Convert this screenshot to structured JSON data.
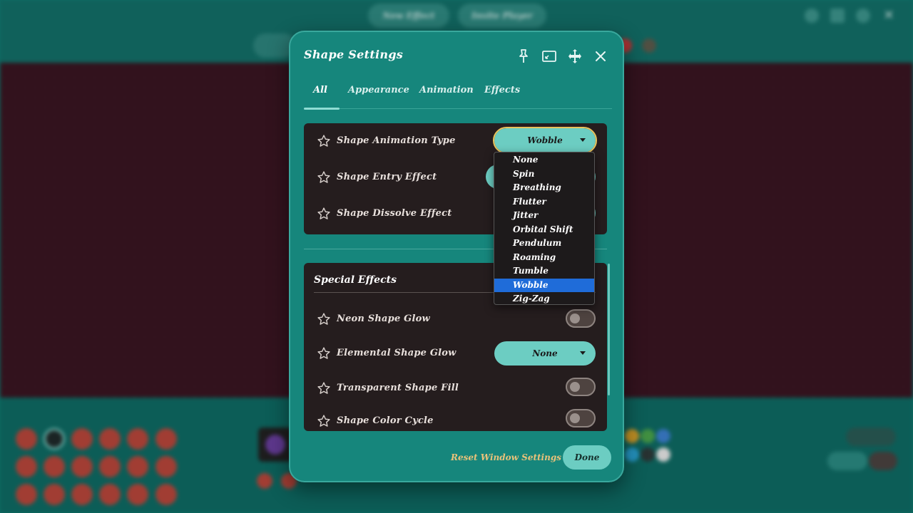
{
  "background_app": {
    "top_buttons": [
      "New Effect",
      "Invite Player"
    ]
  },
  "dialog": {
    "title": "Shape Settings",
    "tabs": [
      {
        "label": "All",
        "active": true
      },
      {
        "label": "Appearance",
        "active": false
      },
      {
        "label": "Animation",
        "active": false
      },
      {
        "label": "Effects",
        "active": false
      }
    ],
    "animation_settings": [
      {
        "label": "Shape Animation Type",
        "value": "Wobble"
      },
      {
        "label": "Shape Entry Effect"
      },
      {
        "label": "Shape Dissolve Effect"
      }
    ],
    "special_effects": {
      "title": "Special Effects",
      "rows": [
        {
          "label": "Neon Shape Glow",
          "control": "toggle",
          "on": false
        },
        {
          "label": "Elemental Shape Glow",
          "control": "select",
          "value": "None"
        },
        {
          "label": "Transparent Shape Fill",
          "control": "toggle",
          "on": false
        },
        {
          "label": "Shape Color Cycle",
          "control": "toggle",
          "on": false
        }
      ]
    },
    "reset_label": "Reset Window Settings",
    "done_label": "Done"
  },
  "dropdown": {
    "options": [
      "None",
      "Spin",
      "Breathing",
      "Flutter",
      "Jitter",
      "Orbital Shift",
      "Pendulum",
      "Roaming",
      "Tumble",
      "Wobble",
      "Zig-Zag"
    ],
    "selected": "Wobble"
  },
  "colors": {
    "accent": "#6ccdc2",
    "dialog_bg": "#16867c",
    "panel_bg": "#251d1e",
    "selected_option": "#1f6cd9",
    "link": "#e9c27a"
  }
}
